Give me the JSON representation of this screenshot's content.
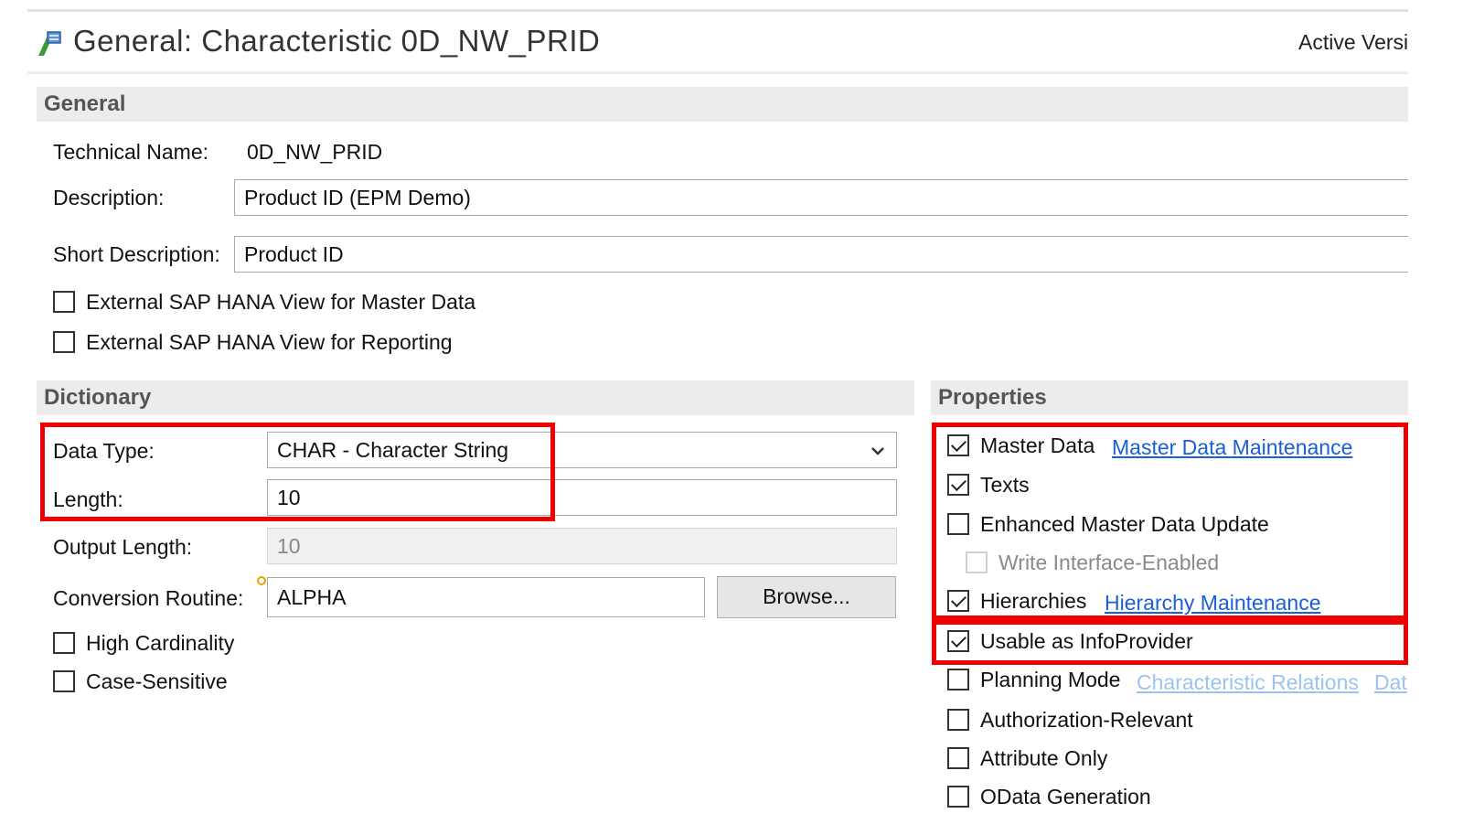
{
  "header": {
    "title": "General: Characteristic 0D_NW_PRID",
    "version": "Active Versi",
    "icon": "characteristic-icon"
  },
  "general": {
    "section_title": "General",
    "technical_name_label": "Technical Name:",
    "technical_name_value": "0D_NW_PRID",
    "description_label": "Description:",
    "description_value": "Product ID (EPM Demo)",
    "short_description_label": "Short Description:",
    "short_description_value": "Product ID",
    "checkboxes": [
      {
        "label": "External SAP HANA View for Master Data",
        "checked": false
      },
      {
        "label": "External SAP HANA View for Reporting",
        "checked": false
      }
    ]
  },
  "dictionary": {
    "section_title": "Dictionary",
    "data_type_label": "Data Type:",
    "data_type_value": "CHAR - Character String",
    "length_label": "Length:",
    "length_value": "10",
    "output_length_label": "Output Length:",
    "output_length_value": "10",
    "conversion_routine_label": "Conversion Routine:",
    "conversion_routine_value": "ALPHA",
    "browse_label": "Browse...",
    "checkboxes": [
      {
        "label": "High Cardinality",
        "checked": false
      },
      {
        "label": "Case-Sensitive",
        "checked": false
      }
    ]
  },
  "properties": {
    "section_title": "Properties",
    "items": [
      {
        "label": "Master Data",
        "checked": true,
        "link": "Master Data Maintenance"
      },
      {
        "label": "Texts",
        "checked": true
      },
      {
        "label": "Enhanced Master Data Update",
        "checked": false
      },
      {
        "label": "Write Interface-Enabled",
        "checked": false,
        "disabled": true
      },
      {
        "label": "Hierarchies",
        "checked": true,
        "link": "Hierarchy Maintenance"
      },
      {
        "label": "Usable as InfoProvider",
        "checked": true
      },
      {
        "label": "Planning Mode",
        "checked": false,
        "link": "Characteristic Relations",
        "link2": "Dat"
      },
      {
        "label": "Authorization-Relevant",
        "checked": false
      },
      {
        "label": "Attribute Only",
        "checked": false
      },
      {
        "label": "OData Generation",
        "checked": false
      }
    ]
  },
  "colors": {
    "highlight": "#ee0000",
    "link": "#1a5fd6",
    "section_bg": "#ececec"
  }
}
